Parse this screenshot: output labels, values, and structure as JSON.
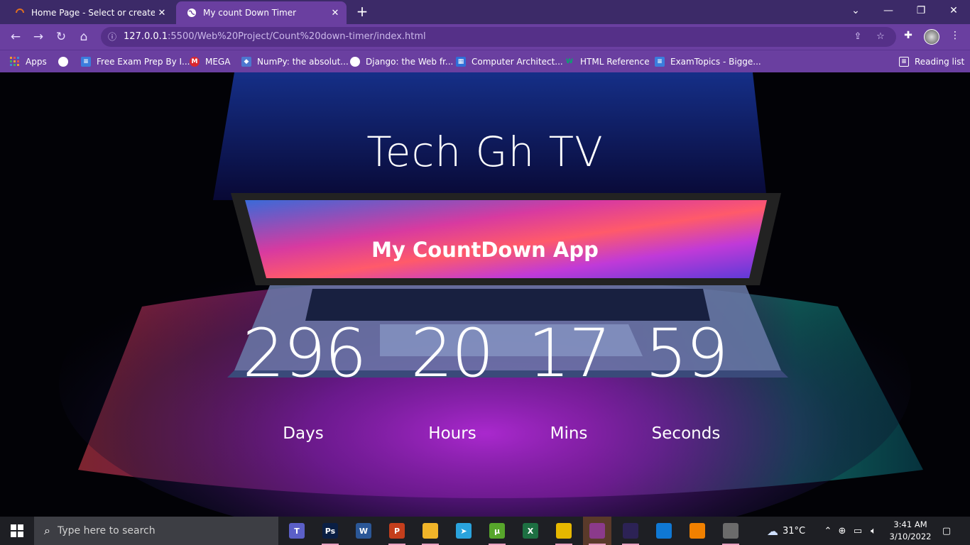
{
  "browser": {
    "tabs": [
      {
        "title": "Home Page - Select or create a n",
        "icon": "loading-icon",
        "active": false
      },
      {
        "title": "My count Down Timer",
        "icon": "globe-icon",
        "active": true
      }
    ],
    "url_host": "127.0.0.1",
    "url_rest": ":5500/Web%20Project/Count%20down-timer/index.html",
    "bookmarks": [
      {
        "label": "Apps",
        "icon": "apps-grid-icon",
        "color": "#e0a030"
      },
      {
        "label": "",
        "icon": "globe-icon",
        "color": "#ffffff"
      },
      {
        "label": "Free Exam Prep By I...",
        "icon": "document-icon",
        "color": "#3b7ddd"
      },
      {
        "label": "MEGA",
        "icon": "mega-icon",
        "color": "#d9272e"
      },
      {
        "label": "NumPy: the absolut...",
        "icon": "numpy-icon",
        "color": "#4d77cf"
      },
      {
        "label": "Django: the Web fr...",
        "icon": "globe-icon",
        "color": "#ffffff"
      },
      {
        "label": "Computer Architect...",
        "icon": "calendar-icon",
        "color": "#2f6fd8"
      },
      {
        "label": "HTML Reference",
        "icon": "w3-icon",
        "color": "#04aa6d"
      },
      {
        "label": "ExamTopics - Bigge...",
        "icon": "document-icon",
        "color": "#3b7ddd"
      }
    ],
    "reading_list": "Reading list"
  },
  "page": {
    "heading": "Tech Gh TV",
    "subheading": "My CountDown App",
    "countdown": [
      {
        "value": "296",
        "label": "Days"
      },
      {
        "value": "20",
        "label": "Hours"
      },
      {
        "value": "17",
        "label": "Mins"
      },
      {
        "value": "59",
        "label": "Seconds"
      }
    ]
  },
  "taskbar": {
    "search_placeholder": "Type here to search",
    "apps": [
      {
        "name": "teams-icon",
        "text": "T",
        "color": "#5b5fc7"
      },
      {
        "name": "photoshop-icon",
        "text": "Ps",
        "color": "#0a1f44"
      },
      {
        "name": "word-icon",
        "text": "W",
        "color": "#2b5797"
      },
      {
        "name": "powerpoint-icon",
        "text": "P",
        "color": "#c43e1c"
      },
      {
        "name": "file-explorer-icon",
        "text": "",
        "color": "#f0b429"
      },
      {
        "name": "telegram-icon",
        "text": "➤",
        "color": "#2aa3dd"
      },
      {
        "name": "utorrent-icon",
        "text": "µ",
        "color": "#57a62b"
      },
      {
        "name": "excel-icon",
        "text": "X",
        "color": "#1d6f42"
      },
      {
        "name": "power-bi-icon",
        "text": "",
        "color": "#e6b800"
      },
      {
        "name": "winrar-icon",
        "text": "",
        "color": "#8b3a8b"
      },
      {
        "name": "eclipse-icon",
        "text": "",
        "color": "#2c2255"
      },
      {
        "name": "vscode-icon",
        "text": "",
        "color": "#0f78d4"
      },
      {
        "name": "vlc-icon",
        "text": "",
        "color": "#f08000"
      },
      {
        "name": "chrome-icon",
        "text": "",
        "color": "#6b6b6b"
      }
    ],
    "weather": "31°C",
    "time": "3:41 AM",
    "date": "3/10/2022"
  }
}
